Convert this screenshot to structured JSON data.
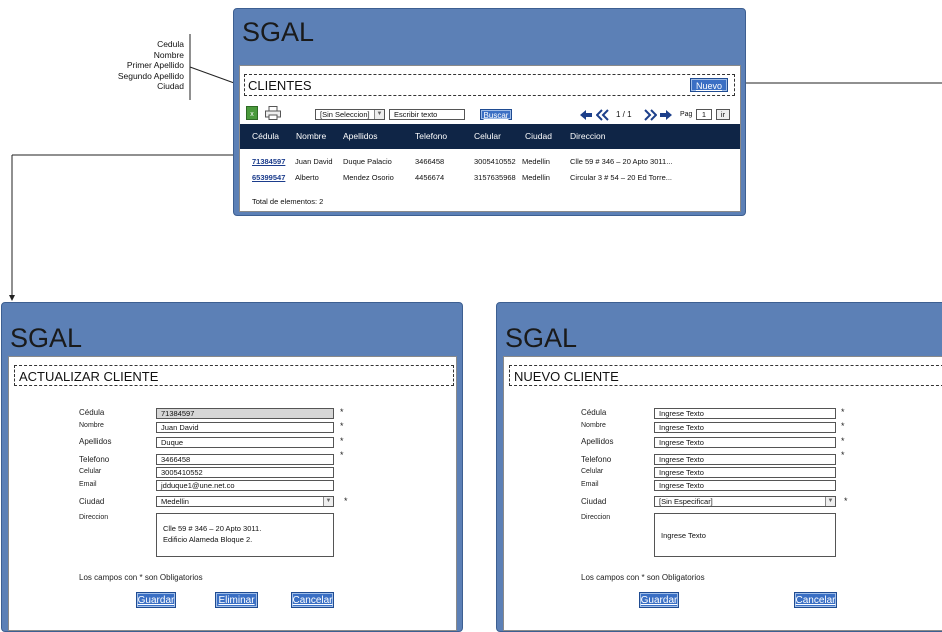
{
  "app_title": "SGAL",
  "annotation": {
    "fields": [
      "Cedula",
      "Nombre",
      "Primer Apellido",
      "Segundo Apellido",
      "Ciudad"
    ]
  },
  "clientes": {
    "section_title": "CLIENTES",
    "nuevo_label": "Nuevo",
    "filter_select": "[Sin Seleccion]",
    "search_placeholder": "Escribir texto",
    "buscar_label": "Buscar",
    "page_info": "1 / 1",
    "pag_label": "Pag",
    "page_value": "1",
    "ir_label": "ir",
    "columns": [
      "Cédula",
      "Nombre",
      "Apellidos",
      "Telefono",
      "Celular",
      "Ciudad",
      "Direccion"
    ],
    "rows": [
      {
        "cedula": "71384597",
        "nombre": "Juan David",
        "apellidos": "Duque Palacio",
        "telefono": "3466458",
        "celular": "3005410552",
        "ciudad": "Medellin",
        "direccion": "Clle 59 # 346 – 20 Apto 3011..."
      },
      {
        "cedula": "65399547",
        "nombre": "Alberto",
        "apellidos": "Mendez Osorio",
        "telefono": "4456674",
        "celular": "3157635968",
        "ciudad": "Medellin",
        "direccion": "Circular 3 # 54 – 20 Ed Torre..."
      }
    ],
    "total": "Total de elementos: 2"
  },
  "actualizar": {
    "section_title": "ACTUALIZAR CLIENTE",
    "labels": {
      "cedula": "Cédula",
      "nombre": "Nombre",
      "apellidos": "Apellidos",
      "telefono": "Telefono",
      "celular": "Celular",
      "email": "Email",
      "ciudad": "Ciudad",
      "direccion": "Direccion"
    },
    "values": {
      "cedula": "71384597",
      "nombre": "Juan David",
      "apellidos": "Duque",
      "telefono": "3466458",
      "celular": "3005410552",
      "email": "jdduque1@une.net.co",
      "ciudad": "Medellin",
      "direccion_1": "Clle 59 # 346 – 20 Apto 3011.",
      "direccion_2": "Edificio Alameda Bloque 2."
    },
    "required_note": "Los campos con * son Obligatorios",
    "guardar_label": "Guardar",
    "eliminar_label": "Eliminar",
    "cancelar_label": "Cancelar"
  },
  "nuevo": {
    "section_title": "NUEVO CLIENTE",
    "labels": {
      "cedula": "Cédula",
      "nombre": "Nombre",
      "apellidos": "Apellidos",
      "telefono": "Telefono",
      "celular": "Celular",
      "email": "Email",
      "ciudad": "Ciudad",
      "direccion": "Direccion"
    },
    "placeholder": "Ingrese Texto",
    "ciudad_value": "[Sin Especificar]",
    "required_note": "Los campos con * son Obligatorios",
    "guardar_label": "Guardar",
    "cancelar_label": "Cancelar"
  },
  "required_mark": "*",
  "icons": [
    "excel-icon",
    "printer-icon",
    "arrow-left-icon",
    "double-left-icon",
    "double-right-icon",
    "arrow-right-icon"
  ],
  "colors": {
    "window": "#5c80b6",
    "header_bar": "#0f2546",
    "button": "#3a6fc4"
  }
}
